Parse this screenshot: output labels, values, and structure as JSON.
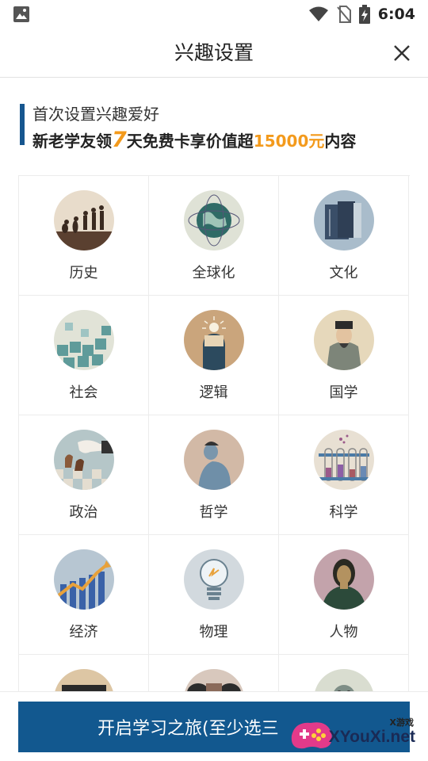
{
  "status_bar": {
    "time": "6:04"
  },
  "header": {
    "title": "兴趣设置"
  },
  "promo": {
    "line1": "首次设置兴趣爱好",
    "line2_prefix": "新老学友领",
    "line2_days": "7",
    "line2_middle": "天免费卡享价值超",
    "line2_amount": "15000元",
    "line2_suffix": "内容"
  },
  "topics": [
    {
      "label": "历史",
      "icon": "history-evolution-icon"
    },
    {
      "label": "全球化",
      "icon": "globe-icon"
    },
    {
      "label": "文化",
      "icon": "books-icon"
    },
    {
      "label": "社会",
      "icon": "puzzle-icon"
    },
    {
      "label": "逻辑",
      "icon": "head-idea-icon"
    },
    {
      "label": "国学",
      "icon": "scholar-portrait-icon"
    },
    {
      "label": "政治",
      "icon": "chess-hand-icon"
    },
    {
      "label": "哲学",
      "icon": "thinker-icon"
    },
    {
      "label": "科学",
      "icon": "test-tubes-icon"
    },
    {
      "label": "经济",
      "icon": "growth-chart-icon"
    },
    {
      "label": "物理",
      "icon": "lightbulb-icon"
    },
    {
      "label": "人物",
      "icon": "mona-lisa-icon"
    },
    {
      "label": "",
      "icon": "partial-icon-1"
    },
    {
      "label": "",
      "icon": "partial-icon-2"
    },
    {
      "label": "",
      "icon": "partial-icon-3"
    }
  ],
  "footer": {
    "start_label": "开启学习之旅(至少选三"
  },
  "watermark": {
    "line1": "X游戏",
    "line2": "XYouXi.net"
  },
  "colors": {
    "brand": "#12588f",
    "accent": "#f39a1c"
  }
}
